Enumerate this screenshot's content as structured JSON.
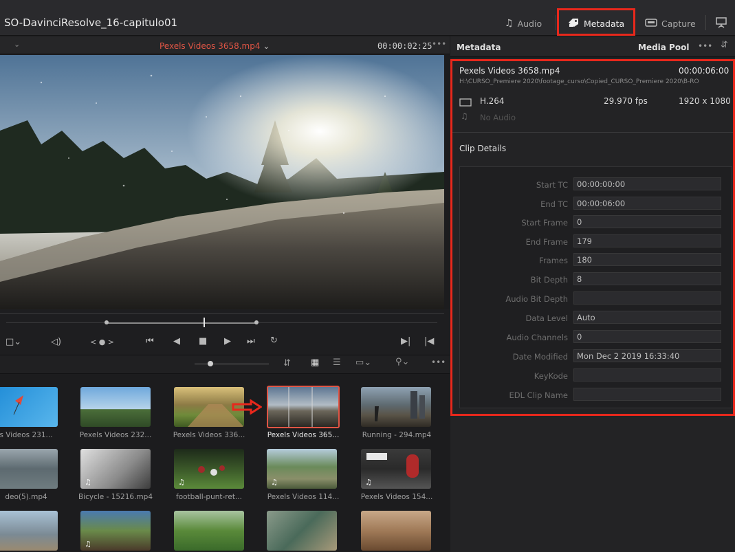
{
  "app": {
    "project_title": "SO-DavinciResolve_16-capitulo01"
  },
  "topbar": {
    "audio_label": "Audio",
    "metadata_label": "Metadata",
    "capture_label": "Capture"
  },
  "viewer": {
    "clip_name": "Pexels Videos 3658.mp4",
    "timecode": "00:00:02:25",
    "more": "•••"
  },
  "metadata_panel": {
    "title": "Metadata",
    "pool_label": "Media Pool",
    "file_name": "Pexels Videos 3658.mp4",
    "duration": "00:00:06:00",
    "path": "H:\\CURSO_Premiere 2020\\footage_curso\\Copied_CURSO_Premiere 2020\\B-RO",
    "codec": "H.264",
    "fps": "29.970 fps",
    "resolution": "1920 x 1080",
    "audio_status": "No Audio",
    "section_title": "Clip Details",
    "fields": [
      {
        "label": "Start TC",
        "value": "00:00:00:00"
      },
      {
        "label": "End TC",
        "value": "00:00:06:00"
      },
      {
        "label": "Start Frame",
        "value": "0"
      },
      {
        "label": "End Frame",
        "value": "179"
      },
      {
        "label": "Frames",
        "value": "180"
      },
      {
        "label": "Bit Depth",
        "value": "8"
      },
      {
        "label": "Audio Bit Depth",
        "value": ""
      },
      {
        "label": "Data Level",
        "value": "Auto"
      },
      {
        "label": "Audio Channels",
        "value": "0"
      },
      {
        "label": "Date Modified",
        "value": "Mon Dec 2 2019 16:33:40"
      },
      {
        "label": "KeyKode",
        "value": ""
      },
      {
        "label": "EDL Clip Name",
        "value": ""
      }
    ]
  },
  "media_pool": {
    "clips": [
      {
        "label": "s Videos 231..."
      },
      {
        "label": "Pexels Videos 232..."
      },
      {
        "label": "Pexels Videos 336..."
      },
      {
        "label": "Pexels Videos 365..."
      },
      {
        "label": "Running - 294.mp4"
      },
      {
        "label": "deo(5).mp4"
      },
      {
        "label": "Bicycle - 15216.mp4"
      },
      {
        "label": "football-punt-ret..."
      },
      {
        "label": "Pexels Videos 114..."
      },
      {
        "label": "Pexels Videos 154..."
      }
    ]
  },
  "colors": {
    "highlight": "#e8281c",
    "clip_name": "#e05545"
  }
}
